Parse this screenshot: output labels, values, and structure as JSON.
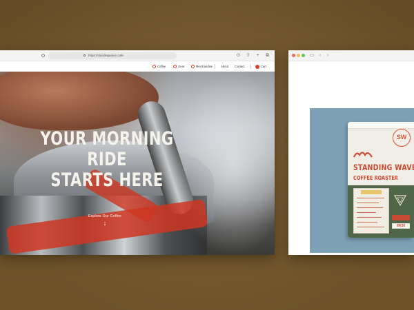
{
  "left_window": {
    "url": "https://standingwave.cafe",
    "nav": {
      "items": [
        {
          "label": "Coffee",
          "icon": "coffee-bean-icon"
        },
        {
          "label": "Gear",
          "icon": "gear-kettle-icon"
        },
        {
          "label": "Merchandise",
          "icon": "shopping-bag-icon"
        },
        {
          "label": "About"
        },
        {
          "label": "Contact"
        },
        {
          "label": "Cart",
          "icon": "cart-badge-icon"
        }
      ]
    },
    "hero": {
      "title_line1": "YOUR MORNING RIDE",
      "title_line2": "STARTS HERE",
      "cta": "Explore Our Coffee"
    }
  },
  "right_window": {
    "product": {
      "stamp": "SW",
      "brand": "STANDING WAVE",
      "subtitle": "COFFEE ROASTER",
      "number": "09|30"
    }
  },
  "colors": {
    "accent_red": "#d8402b",
    "desktop_brown": "#7a5c2e",
    "bag_green": "#4f6649",
    "product_blue": "#7ea1b5"
  }
}
